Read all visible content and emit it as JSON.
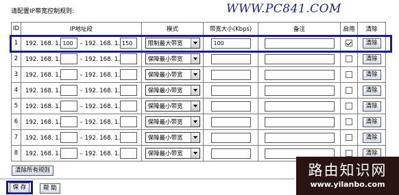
{
  "intro": "请配置IP带宽控制规则:",
  "watermark": "WWW.PC841.COM",
  "headers": {
    "id": "ID",
    "ip_range": "IP地址段",
    "mode": "模式",
    "bandwidth": "带宽大小(Kbps)",
    "note": "备注",
    "enable": "启用",
    "clear": "清除"
  },
  "ip_prefix": "192. 168. 1.",
  "range_sep": "–",
  "rows": [
    {
      "id": "1",
      "ip_start": "100",
      "ip_end": "150",
      "mode": "限制最大带宽",
      "bandwidth": "100",
      "note": "",
      "enabled": true,
      "clear_label": "清除"
    },
    {
      "id": "2",
      "ip_start": "",
      "ip_end": "",
      "mode": "保障最小带宽",
      "bandwidth": "",
      "note": "",
      "enabled": false,
      "clear_label": "清除"
    },
    {
      "id": "3",
      "ip_start": "",
      "ip_end": "",
      "mode": "保障最小带宽",
      "bandwidth": "",
      "note": "",
      "enabled": false,
      "clear_label": "清除"
    },
    {
      "id": "4",
      "ip_start": "",
      "ip_end": "",
      "mode": "保障最小带宽",
      "bandwidth": "",
      "note": "",
      "enabled": false,
      "clear_label": "清除"
    },
    {
      "id": "5",
      "ip_start": "",
      "ip_end": "",
      "mode": "保障最小带宽",
      "bandwidth": "",
      "note": "",
      "enabled": false,
      "clear_label": "清除"
    },
    {
      "id": "6",
      "ip_start": "",
      "ip_end": "",
      "mode": "保障最小带宽",
      "bandwidth": "",
      "note": "",
      "enabled": false,
      "clear_label": "清除"
    },
    {
      "id": "7",
      "ip_start": "",
      "ip_end": "",
      "mode": "保障最小带宽",
      "bandwidth": "",
      "note": "",
      "enabled": false,
      "clear_label": "清除"
    },
    {
      "id": "8",
      "ip_start": "",
      "ip_end": "",
      "mode": "保障最小带宽",
      "bandwidth": "",
      "note": "",
      "enabled": false,
      "clear_label": "清除"
    }
  ],
  "buttons": {
    "clear_all": "清除所有规则",
    "save": "保 存",
    "help": "帮 助"
  },
  "logo": {
    "title": "路由知识网",
    "url": "www.yilanbo.com"
  },
  "colors": {
    "highlight": "#161a95",
    "watermark": "#1b1e8a",
    "logo_bg": "#2a1411"
  }
}
